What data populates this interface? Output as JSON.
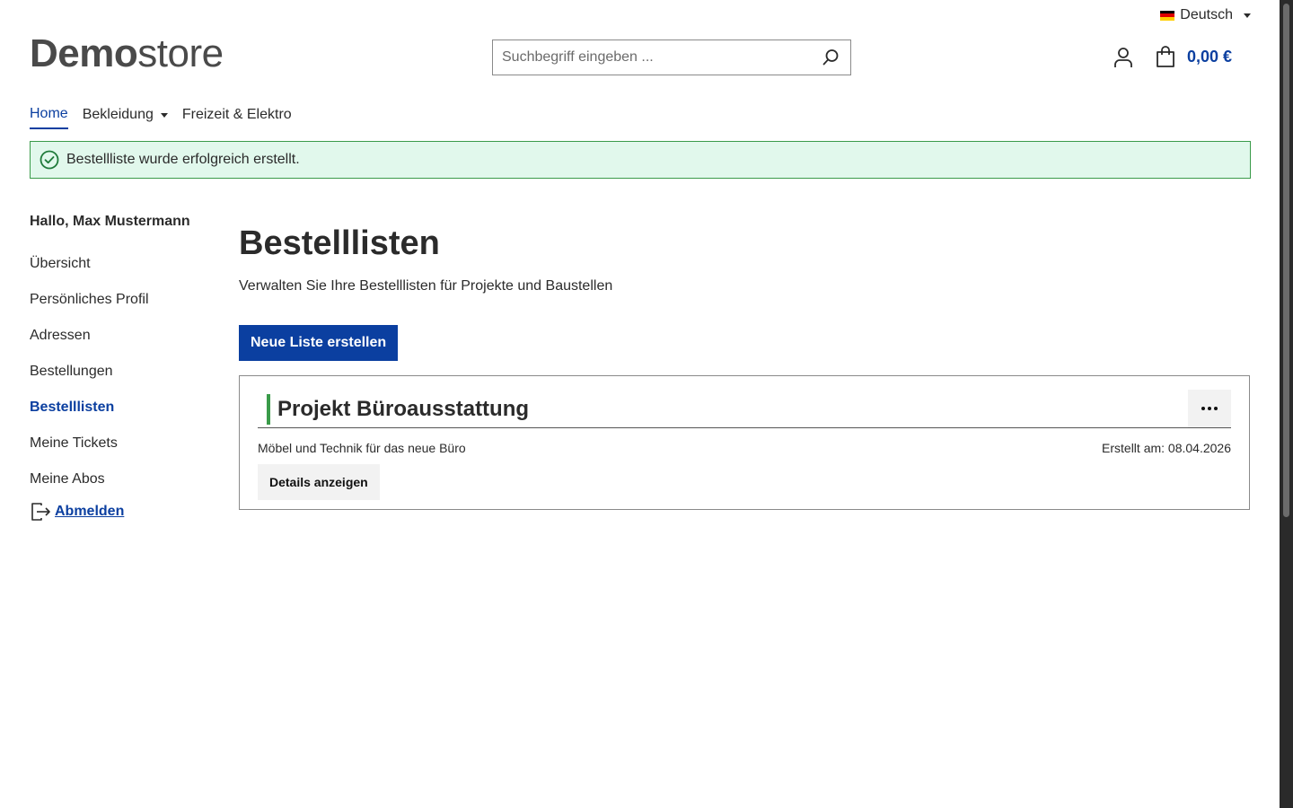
{
  "header": {
    "language": {
      "label": "Deutsch",
      "flag_icon": "germany-flag-icon"
    },
    "logo": {
      "bold": "Demo",
      "light": "store"
    },
    "search": {
      "placeholder": "Suchbegriff eingeben ...",
      "value": ""
    },
    "cart_total": "0,00 €"
  },
  "nav": {
    "items": [
      {
        "label": "Home",
        "active": true,
        "dropdown": false
      },
      {
        "label": "Bekleidung",
        "active": false,
        "dropdown": true
      },
      {
        "label": "Freizeit & Elektro",
        "active": false,
        "dropdown": false
      }
    ]
  },
  "alert": {
    "message": "Bestellliste wurde erfolgreich erstellt."
  },
  "sidebar": {
    "greeting": "Hallo, Max Mustermann",
    "items": [
      {
        "label": "Übersicht"
      },
      {
        "label": "Persönliches Profil"
      },
      {
        "label": "Adressen"
      },
      {
        "label": "Bestellungen"
      },
      {
        "label": "Bestelllisten",
        "active": true
      },
      {
        "label": "Meine Tickets"
      },
      {
        "label": "Meine Abos"
      }
    ],
    "logout": "Abmelden"
  },
  "main": {
    "title": "Bestelllisten",
    "subtitle": "Verwalten Sie Ihre Bestelllisten für Projekte und Baustellen",
    "new_list_button": "Neue Liste erstellen",
    "lists": [
      {
        "title": "Projekt Büroausstattung",
        "description": "Möbel und Technik für das neue Büro",
        "created": "Erstellt am: 08.04.2026",
        "details_button": "Details anzeigen"
      }
    ]
  },
  "colors": {
    "accent": "#0b3fa0",
    "success_border": "#3a9b4a",
    "success_bg": "#e1f8ec"
  }
}
